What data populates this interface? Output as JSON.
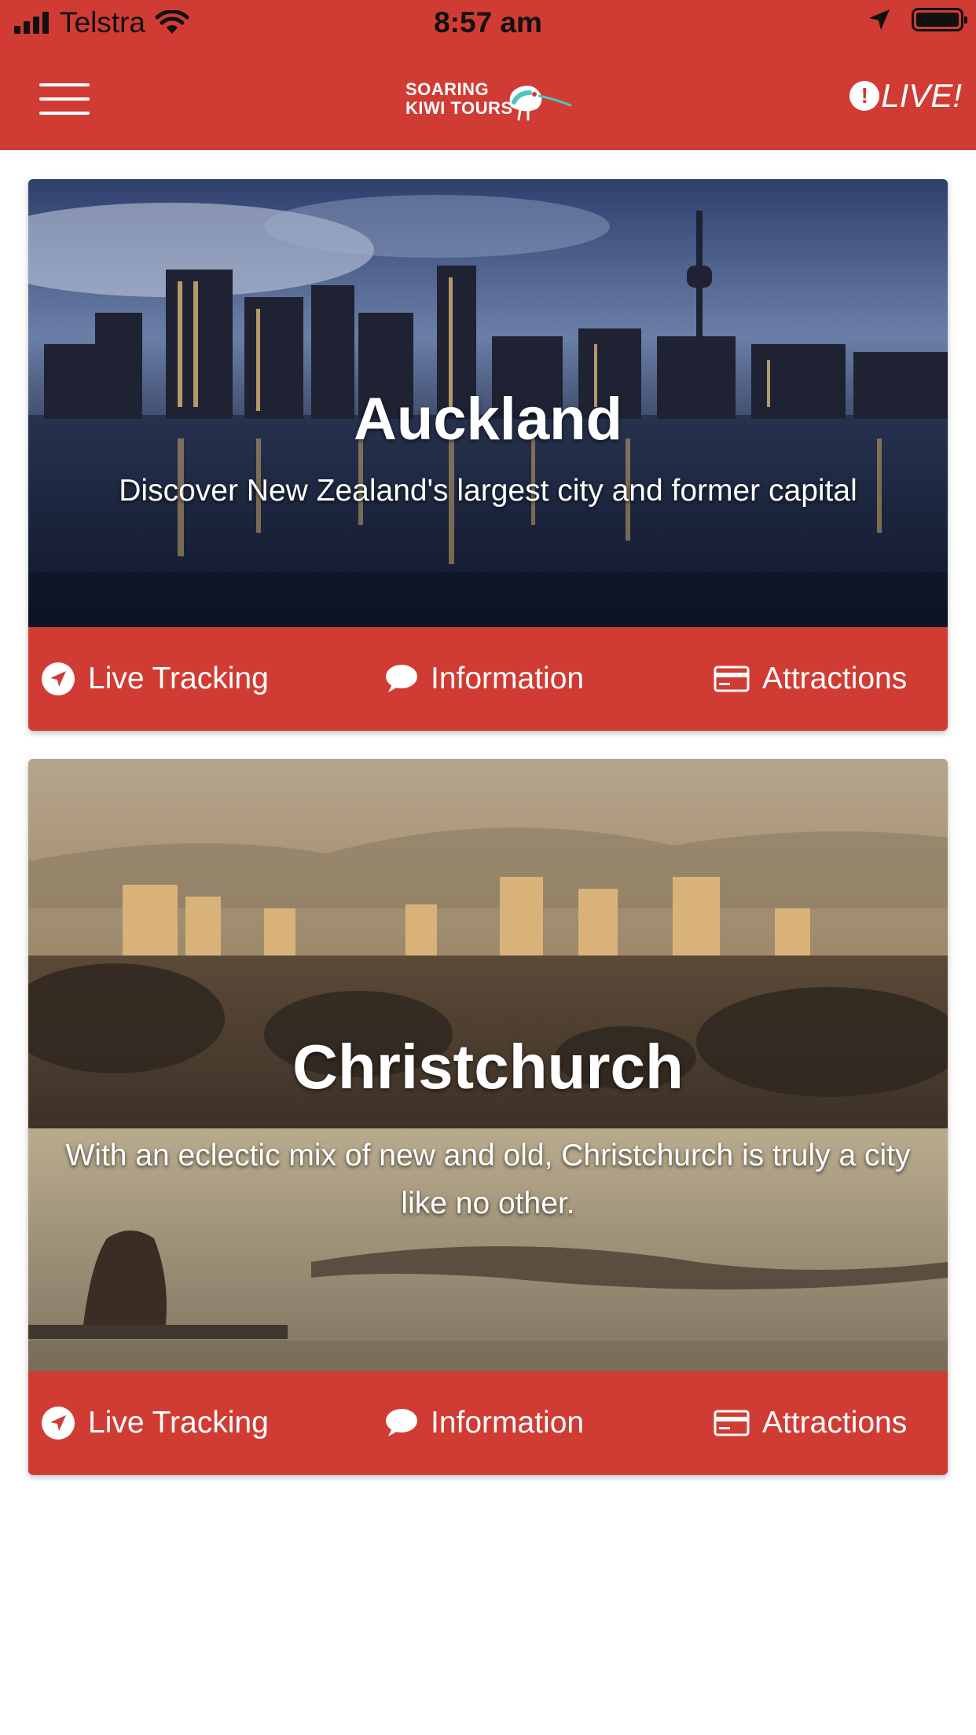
{
  "status_bar": {
    "carrier": "Telstra",
    "time": "8:57 am"
  },
  "nav": {
    "logo_line1": "SOARING",
    "logo_line2": "KIWI TOURS",
    "live_badge": "!",
    "live_label": "LIVE!"
  },
  "cards": [
    {
      "title": "Auckland",
      "subtitle": "Discover New Zealand's largest city and former capital",
      "actions": {
        "tracking": "Live Tracking",
        "information": "Information",
        "attractions": "Attractions"
      }
    },
    {
      "title": "Christchurch",
      "subtitle": "With an eclectic mix of new and old, Christchurch is truly a city like no other.",
      "actions": {
        "tracking": "Live Tracking",
        "information": "Information",
        "attractions": "Attractions"
      }
    }
  ],
  "colors": {
    "brand": "#d03c33",
    "logo_accent": "#4fc3c0"
  }
}
